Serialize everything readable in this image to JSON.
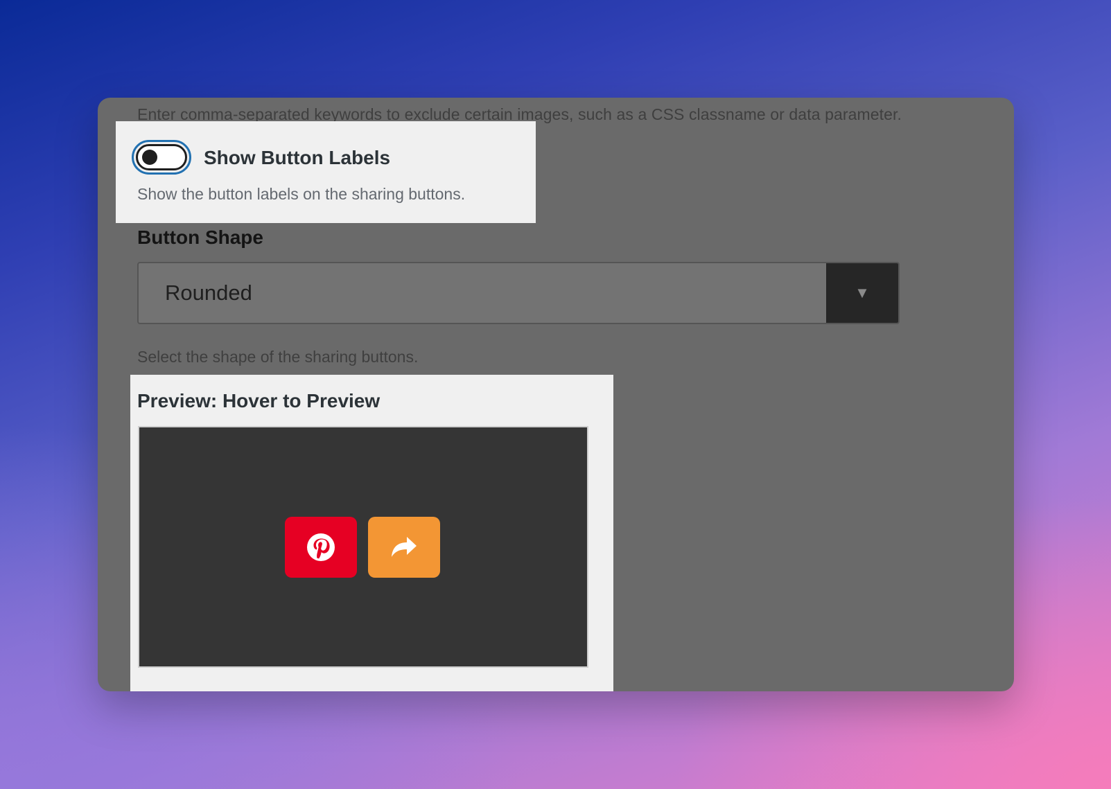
{
  "settings": {
    "exclude_images_help": "Enter comma-separated keywords to exclude certain images, such as a CSS classname or data parameter.",
    "show_button_labels": {
      "label": "Show Button Labels",
      "enabled": false,
      "help": "Show the button labels on the sharing buttons."
    },
    "button_shape": {
      "label": "Button Shape",
      "selected": "Rounded",
      "dropdown_icon": "▼",
      "help": "Select the shape of the sharing buttons."
    },
    "preview": {
      "title": "Preview: Hover to Preview",
      "buttons": [
        {
          "network": "pinterest",
          "icon": "pinterest-icon",
          "color": "#e60023"
        },
        {
          "network": "share",
          "icon": "share-arrow-icon",
          "color": "#f39634"
        }
      ]
    }
  },
  "colors": {
    "toggle_focus": "#2271b1",
    "panel": "#6a6a6a",
    "card": "#f0f0f0",
    "preview_stage": "#353535"
  }
}
